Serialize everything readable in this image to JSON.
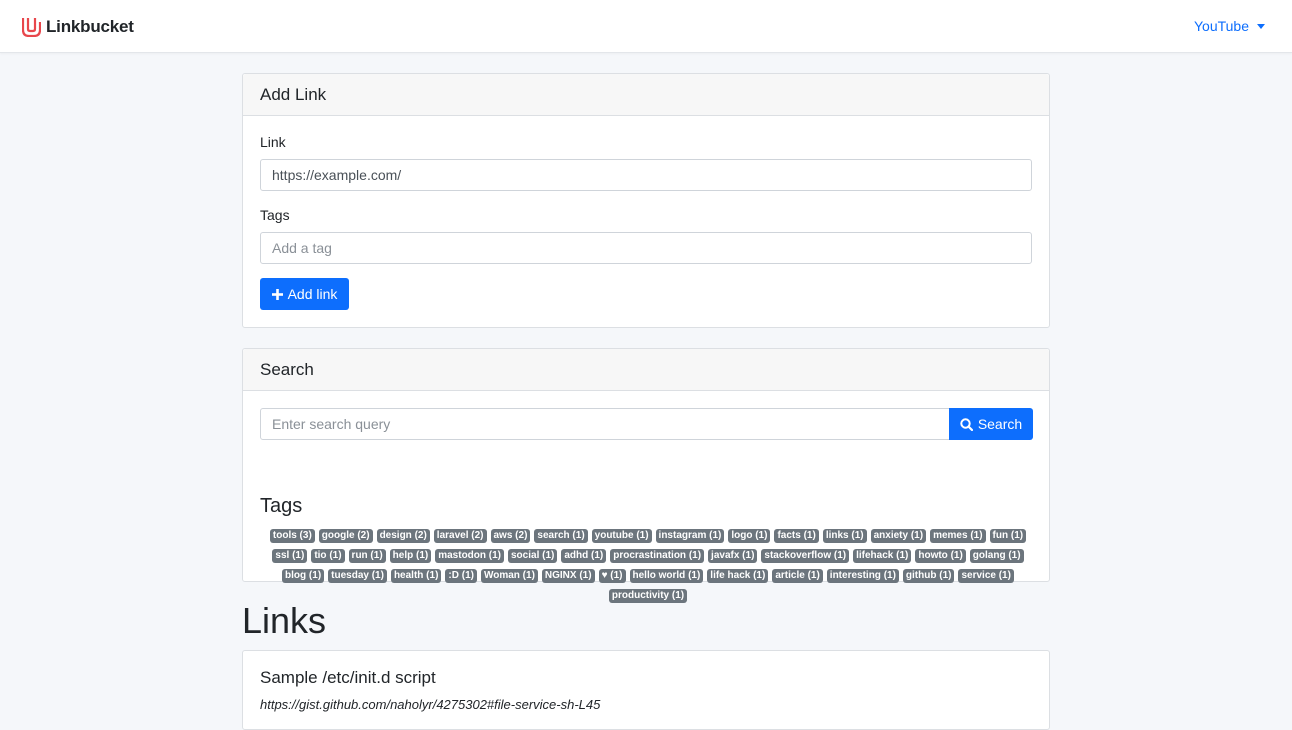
{
  "navbar": {
    "brand": "Linkbucket",
    "dropdown_label": "YouTube"
  },
  "add_link": {
    "title": "Add Link",
    "link_label": "Link",
    "link_value": "https://example.com/",
    "tags_label": "Tags",
    "tags_placeholder": "Add a tag",
    "button_label": "Add link"
  },
  "search": {
    "title": "Search",
    "placeholder": "Enter search query",
    "button_label": "Search",
    "tags_heading": "Tags",
    "tags": [
      "tools (3)",
      "google (2)",
      "design (2)",
      "laravel (2)",
      "aws (2)",
      "search (1)",
      "youtube (1)",
      "instagram (1)",
      "logo (1)",
      "facts (1)",
      "links (1)",
      "anxiety (1)",
      "memes (1)",
      "fun (1)",
      "ssl (1)",
      "tio (1)",
      "run (1)",
      "help (1)",
      "mastodon (1)",
      "social (1)",
      "adhd (1)",
      "procrastination (1)",
      "javafx (1)",
      "stackoverflow (1)",
      "lifehack (1)",
      "howto (1)",
      "golang (1)",
      "blog (1)",
      "tuesday (1)",
      "health (1)",
      ":D (1)",
      "Woman (1)",
      "NGINX (1)",
      "♥ (1)",
      "hello world (1)",
      "life hack (1)",
      "article (1)",
      "interesting (1)",
      "github (1)",
      "service (1)",
      "productivity (1)"
    ]
  },
  "links": {
    "heading": "Links",
    "items": [
      {
        "title": "Sample /etc/init.d script",
        "url": "https://gist.github.com/naholyr/4275302#file-service-sh-L45"
      }
    ]
  },
  "colors": {
    "primary": "#0d6efd",
    "badge": "#6c757d",
    "brand_logo": "#e8474c"
  }
}
